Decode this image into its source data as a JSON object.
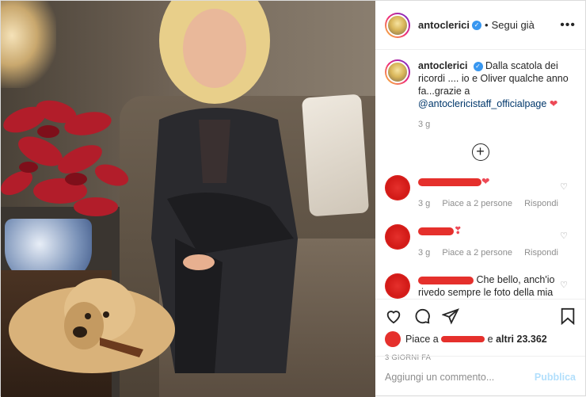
{
  "header": {
    "username": "antoclerici",
    "verified_mark": "✓",
    "dot": "•",
    "follow_label": "Segui già",
    "more_label": "•••"
  },
  "caption": {
    "username": "antoclerici",
    "verified_mark": "✓",
    "text": "Dalla scatola dei ricordi .... io e Oliver qualche anno fa...grazie a",
    "mention": "@antoclericistaff_officialpage",
    "heart": "❤",
    "time": "3 g"
  },
  "load_more_symbol": "+",
  "comments": [
    {
      "text": "",
      "suffix": "❤",
      "time": "3 g",
      "likes": "Piace a 2 persone",
      "reply": "Rispondi",
      "like_icon": "♡"
    },
    {
      "text": "",
      "suffix": "❣",
      "time": "3 g",
      "likes": "Piace a 2 persone",
      "reply": "Rispondi",
      "like_icon": "♡"
    },
    {
      "text": "Che bello, anch'io rivedo sempre le foto della mia",
      "suffix": "",
      "time": "",
      "likes": "",
      "reply": "",
      "like_icon": "♡"
    }
  ],
  "actions": {
    "likes_prefix": "Piace a",
    "likes_suffix": "e",
    "likes_others": "altri 23.362",
    "date": "3 GIORNI FA"
  },
  "add_comment": {
    "placeholder": "Aggiungi un commento...",
    "publish_label": "Pubblica"
  },
  "colors": {
    "accent": "#3897f0",
    "heart": "#ed4956",
    "censor_red": "#e5302c",
    "publish_disabled": "#b2dffc"
  },
  "icons": [
    "heart-icon",
    "comment-icon",
    "share-icon",
    "bookmark-icon",
    "more-icon",
    "plus-circle-icon"
  ]
}
